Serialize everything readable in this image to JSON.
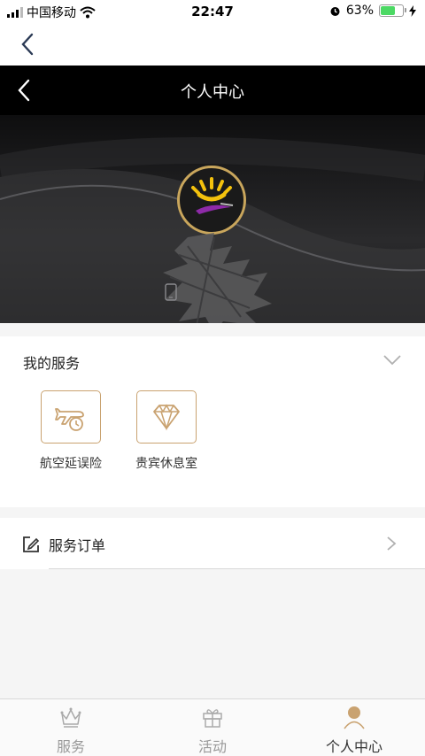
{
  "status_bar": {
    "carrier": "中国移动",
    "time": "22:47",
    "battery": "63%"
  },
  "header": {
    "title": "个人中心"
  },
  "services": {
    "heading": "我的服务",
    "items": [
      {
        "label": "航空延误险",
        "icon": "flight-delay-icon"
      },
      {
        "label": "贵宾休息室",
        "icon": "diamond-icon"
      }
    ]
  },
  "orders": {
    "label": "服务订单"
  },
  "tabs": [
    {
      "label": "服务",
      "icon": "crown-icon",
      "active": false
    },
    {
      "label": "活动",
      "icon": "gift-icon",
      "active": false
    },
    {
      "label": "个人中心",
      "icon": "user-icon",
      "active": true
    }
  ],
  "colors": {
    "accent_gold": "#c9a270",
    "header_bg": "#000000",
    "avatar_border": "#c9a65c"
  }
}
